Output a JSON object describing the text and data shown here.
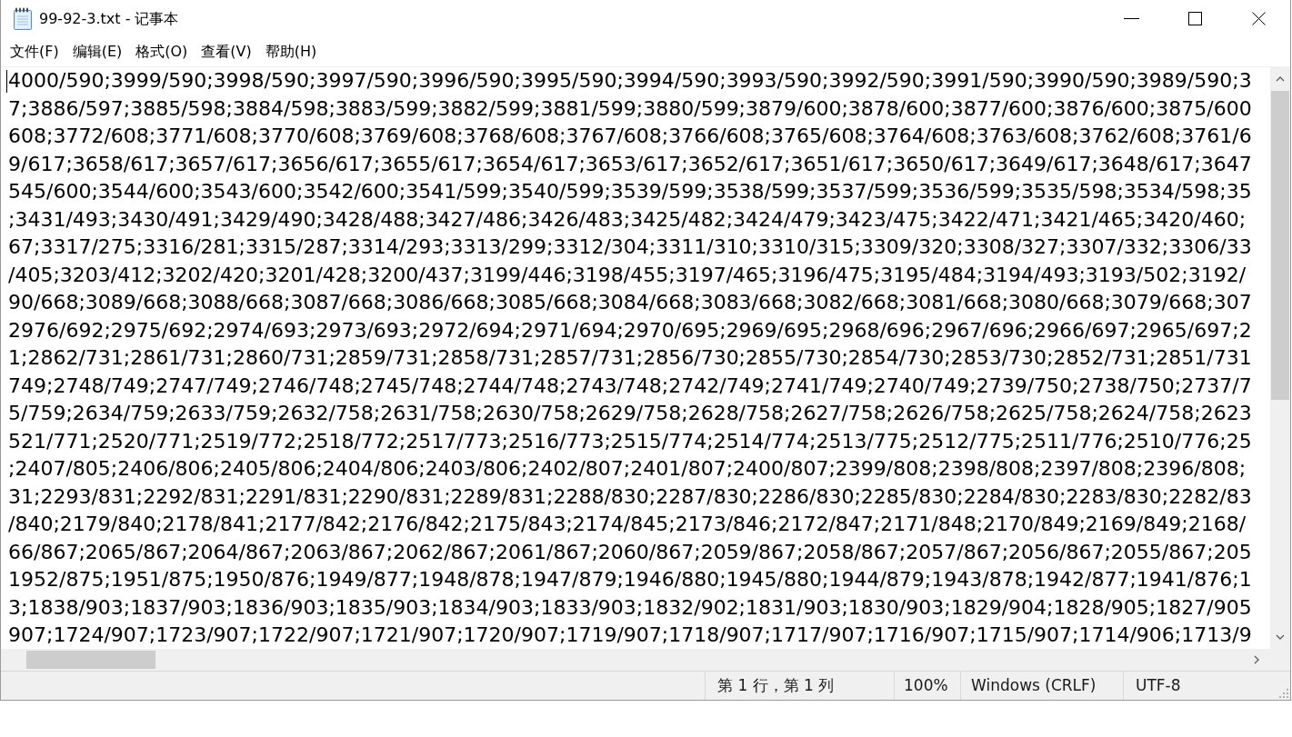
{
  "window": {
    "title": "99-92-3.txt - 记事本"
  },
  "menu_bar": [
    "文件(F)",
    "编辑(E)",
    "格式(O)",
    "查看(V)",
    "帮助(H)"
  ],
  "editor": {
    "lines": [
      "4000/590;3999/590;3998/590;3997/590;3996/590;3995/590;3994/590;3993/590;3992/590;3991/590;3990/590;3989/590;3",
      "7;3886/597;3885/598;3884/598;3883/599;3882/599;3881/599;3880/599;3879/600;3878/600;3877/600;3876/600;3875/600",
      "608;3772/608;3771/608;3770/608;3769/608;3768/608;3767/608;3766/608;3765/608;3764/608;3763/608;3762/608;3761/6",
      "9/617;3658/617;3657/617;3656/617;3655/617;3654/617;3653/617;3652/617;3651/617;3650/617;3649/617;3648/617;3647",
      "545/600;3544/600;3543/600;3542/600;3541/599;3540/599;3539/599;3538/599;3537/599;3536/599;3535/598;3534/598;35",
      ";3431/493;3430/491;3429/490;3428/488;3427/486;3426/483;3425/482;3424/479;3423/475;3422/471;3421/465;3420/460;",
      "67;3317/275;3316/281;3315/287;3314/293;3313/299;3312/304;3311/310;3310/315;3309/320;3308/327;3307/332;3306/33",
      "/405;3203/412;3202/420;3201/428;3200/437;3199/446;3198/455;3197/465;3196/475;3195/484;3194/493;3193/502;3192/",
      "90/668;3089/668;3088/668;3087/668;3086/668;3085/668;3084/668;3083/668;3082/668;3081/668;3080/668;3079/668;307",
      "2976/692;2975/692;2974/693;2973/693;2972/694;2971/694;2970/695;2969/695;2968/696;2967/696;2966/697;2965/697;2",
      "1;2862/731;2861/731;2860/731;2859/731;2858/731;2857/731;2856/730;2855/730;2854/730;2853/730;2852/731;2851/731",
      "749;2748/749;2747/749;2746/748;2745/748;2744/748;2743/748;2742/749;2741/749;2740/749;2739/750;2738/750;2737/7",
      "5/759;2634/759;2633/759;2632/758;2631/758;2630/758;2629/758;2628/758;2627/758;2626/758;2625/758;2624/758;2623",
      "521/771;2520/771;2519/772;2518/772;2517/773;2516/773;2515/774;2514/774;2513/775;2512/775;2511/776;2510/776;25",
      ";2407/805;2406/806;2405/806;2404/806;2403/806;2402/807;2401/807;2400/807;2399/808;2398/808;2397/808;2396/808;",
      "31;2293/831;2292/831;2291/831;2290/831;2289/831;2288/830;2287/830;2286/830;2285/830;2284/830;2283/830;2282/83",
      "/840;2179/840;2178/841;2177/842;2176/842;2175/843;2174/845;2173/846;2172/847;2171/848;2170/849;2169/849;2168/",
      "66/867;2065/867;2064/867;2063/867;2062/867;2061/867;2060/867;2059/867;2058/867;2057/867;2056/867;2055/867;205",
      "1952/875;1951/875;1950/876;1949/877;1948/878;1947/879;1946/880;1945/880;1944/879;1943/878;1942/877;1941/876;1",
      "3;1838/903;1837/903;1836/903;1835/903;1834/903;1833/903;1832/902;1831/903;1830/903;1829/904;1828/905;1827/905",
      "907;1724/907;1723/907;1722/907;1721/907;1720/907;1719/907;1718/907;1717/907;1716/907;1715/907;1714/906;1713/9"
    ]
  },
  "status_bar": {
    "position": "第 1 行，第 1 列",
    "zoom": "100%",
    "line_ending": "Windows (CRLF)",
    "encoding": "UTF-8"
  }
}
